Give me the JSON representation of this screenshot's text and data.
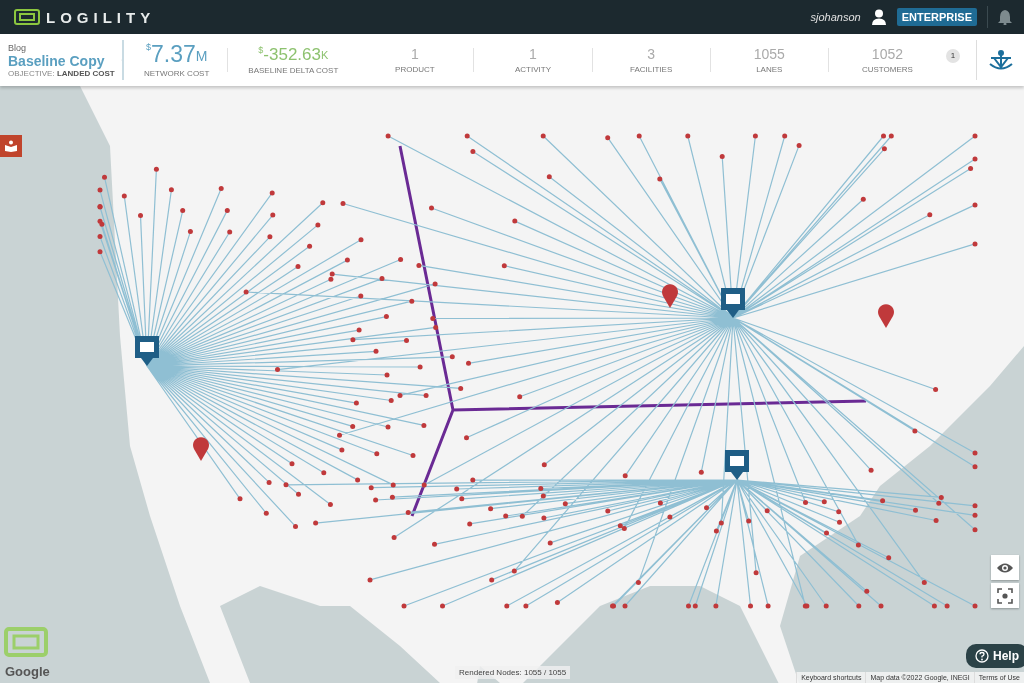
{
  "app": {
    "logo": "LOGILITY",
    "user": "sjohanson",
    "plan": "ENTERPRISE"
  },
  "scenario": {
    "group": "Blog",
    "name": "Baseline Copy",
    "objective_label": "OBJECTIVE:",
    "objective": "LANDED COST"
  },
  "costs": [
    {
      "kind": "total",
      "prefix": "$",
      "value": "7.37",
      "unit": "M",
      "label": "NETWORK COST"
    },
    {
      "kind": "delta",
      "prefix": "$",
      "value": "-352.63",
      "unit": "K",
      "label": "BASELINE DELTA COST"
    }
  ],
  "metrics": [
    {
      "value": "1",
      "label": "PRODUCT"
    },
    {
      "value": "1",
      "label": "ACTIVITY"
    },
    {
      "value": "3",
      "label": "FACILITIES"
    },
    {
      "value": "1055",
      "label": "LANES"
    },
    {
      "value": "1052",
      "label": "CUSTOMERS"
    }
  ],
  "notification_count": "1",
  "map": {
    "provider": "Google",
    "rendered_nodes": "Rendered Nodes: 1055 / 1055",
    "attribution": [
      "Keyboard shortcuts",
      "Map data ©2022 Google, INEGI",
      "Terms of Use"
    ]
  },
  "help": "Help"
}
